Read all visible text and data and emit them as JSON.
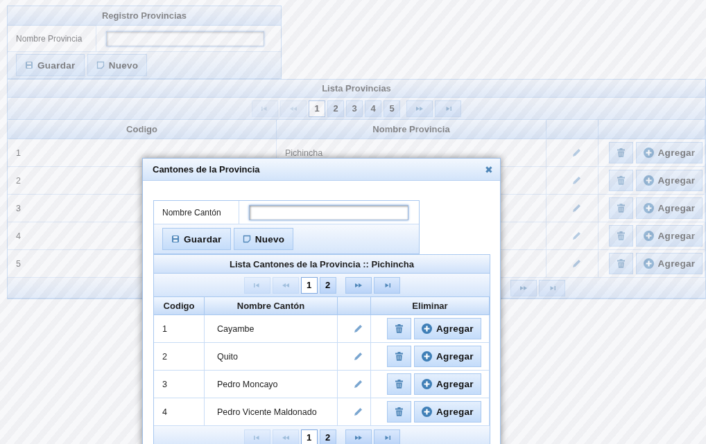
{
  "registro": {
    "title": "Registro Provincias",
    "field": {
      "label": "Nombre Provincia"
    },
    "buttons": [
      "Guardar",
      "Nuevo"
    ]
  },
  "lista": {
    "title": "Lista Provincias",
    "pages": [
      {
        "label": "1",
        "selected": true
      },
      {
        "label": "2",
        "selected": false
      },
      {
        "label": "3",
        "selected": false
      },
      {
        "label": "4",
        "selected": false
      },
      {
        "label": "5",
        "selected": false
      }
    ],
    "columns": [
      "Codigo",
      "Nombre Provincia"
    ],
    "rows": [
      {
        "codigo": "1",
        "nombre": "Pichincha",
        "action": "Agregar"
      },
      {
        "codigo": "2",
        "action": "Agregar"
      },
      {
        "codigo": "3",
        "action": "Agregar"
      },
      {
        "codigo": "4",
        "action": "Agregar"
      },
      {
        "codigo": "5",
        "action": "Agregar"
      }
    ]
  },
  "dialog": {
    "title": "Cantones de la Provincia",
    "close": "✖",
    "field": {
      "label": "Nombre Cantón"
    },
    "buttons": [
      "Guardar",
      "Nuevo"
    ],
    "list": {
      "title": "Lista Cantones de la Provincia :: Pichincha",
      "pages": [
        {
          "label": "1",
          "selected": true
        },
        {
          "label": "2",
          "selected": false
        }
      ],
      "columns": [
        "Codigo",
        "Nombre Cantón",
        "Eliminar"
      ],
      "rows": [
        {
          "codigo": "1",
          "nombre": "Cayambe",
          "action": "Agregar"
        },
        {
          "codigo": "2",
          "nombre": "Quito",
          "action": "Agregar"
        },
        {
          "codigo": "3",
          "nombre": "Pedro Moncayo",
          "action": "Agregar"
        },
        {
          "codigo": "4",
          "nombre": "Pedro Vicente Maldonado",
          "action": "Agregar"
        }
      ],
      "footer_pages": [
        {
          "label": "1",
          "selected": true
        },
        {
          "label": "2",
          "selected": false
        }
      ]
    }
  }
}
